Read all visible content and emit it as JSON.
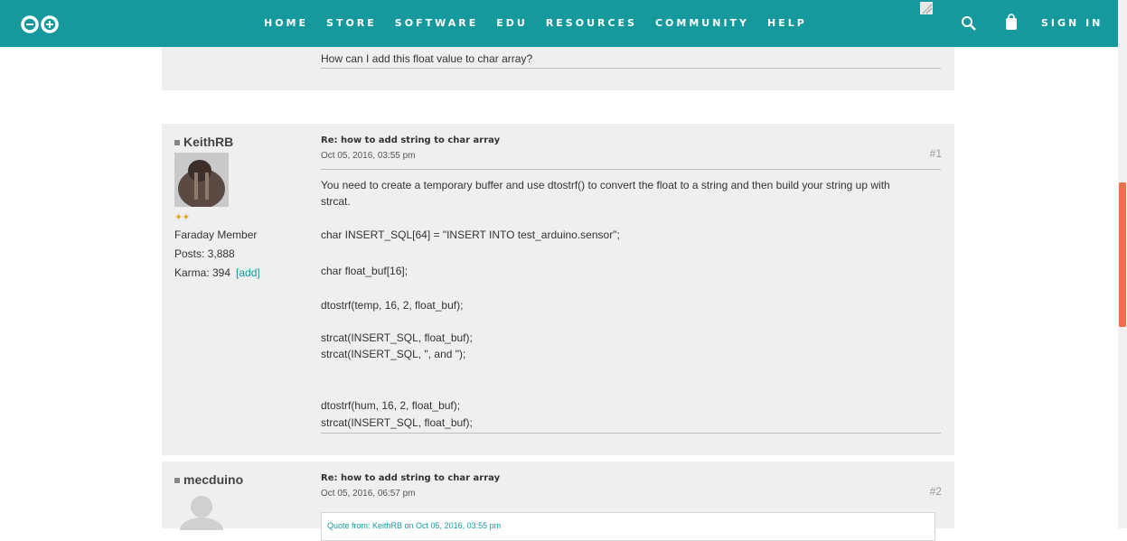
{
  "nav": {
    "items": [
      "HOME",
      "STORE",
      "SOFTWARE",
      "EDU",
      "RESOURCES",
      "COMMUNITY",
      "HELP"
    ],
    "sign_in": "SIGN IN"
  },
  "question_line": "How can I add this float value to char array?",
  "posts": [
    {
      "author": "KeithRB",
      "rank": "Faraday Member",
      "posts": "Posts: 3,888",
      "karma": "Karma: 394",
      "karma_add": "[add]",
      "stars": "✦✦",
      "title": "Re: how to add string to char array",
      "date": "Oct 05, 2016, 03:55 pm",
      "number": "#1",
      "body": [
        "You need to create a temporary buffer and use dtostrf() to convert the float to a string and then build your string up with",
        "strcat.",
        "char INSERT_SQL[64] = \"INSERT INTO test_arduino.sensor\";",
        "char float_buf[16];",
        "dtostrf(temp, 16, 2, float_buf);",
        "strcat(INSERT_SQL, float_buf);",
        "strcat(INSERT_SQL, \", and \");",
        "dtostrf(hum, 16, 2, float_buf);",
        "strcat(INSERT_SQL, float_buf);"
      ]
    },
    {
      "author": "mecduino",
      "title": "Re: how to add string to char array",
      "date": "Oct 05, 2016, 06:57 pm",
      "number": "#2",
      "quote": "Quote from: KeithRB on Oct 05, 2016, 03:55 pm"
    }
  ],
  "colors": {
    "accent": "#16999c",
    "scroll_thumb": "#e9724c",
    "post_bg": "#efefef"
  }
}
